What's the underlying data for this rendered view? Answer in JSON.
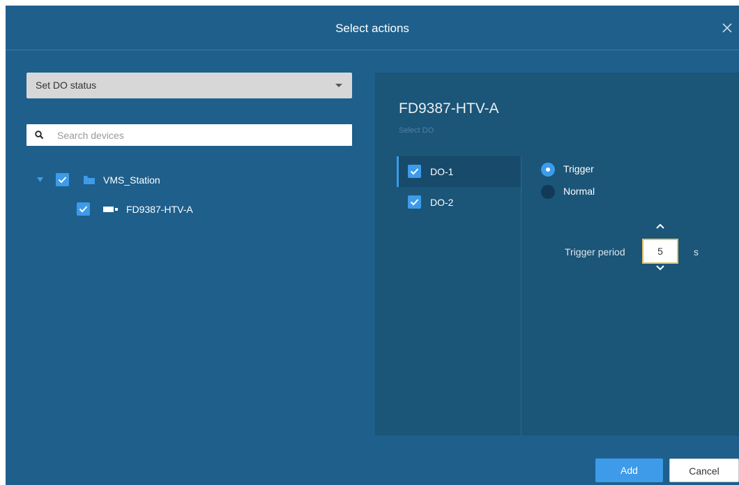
{
  "dialog": {
    "title": "Select actions"
  },
  "action_select": {
    "value": "Set DO status"
  },
  "search": {
    "placeholder": "Search devices",
    "value": ""
  },
  "tree": {
    "station": {
      "label": "VMS_Station",
      "checked": true,
      "expanded": true
    },
    "device": {
      "label": "FD9387-HTV-A",
      "checked": true
    }
  },
  "device_panel": {
    "device_name": "FD9387-HTV-A",
    "select_do_label": "Select DO",
    "do_items": [
      {
        "label": "DO-1",
        "checked": true,
        "active": true
      },
      {
        "label": "DO-2",
        "checked": true,
        "active": false
      }
    ],
    "status_options": [
      {
        "label": "Trigger",
        "selected": true
      },
      {
        "label": "Normal",
        "selected": false
      }
    ],
    "trigger_period": {
      "label": "Trigger period",
      "value": "5",
      "unit": "s"
    }
  },
  "footer": {
    "add_label": "Add",
    "cancel_label": "Cancel"
  },
  "colors": {
    "dialog_bg": "#1e5f8c",
    "panel_bg": "#1b5578",
    "accent": "#3d9be9",
    "input_border_focus": "#ddc36a"
  },
  "icons": {
    "close": "close-icon",
    "search": "search-icon",
    "expand": "triangle-down-icon",
    "folder": "folder-icon",
    "camera": "camera-icon",
    "check": "check-icon",
    "up": "chevron-up-icon",
    "down": "chevron-down-icon"
  }
}
